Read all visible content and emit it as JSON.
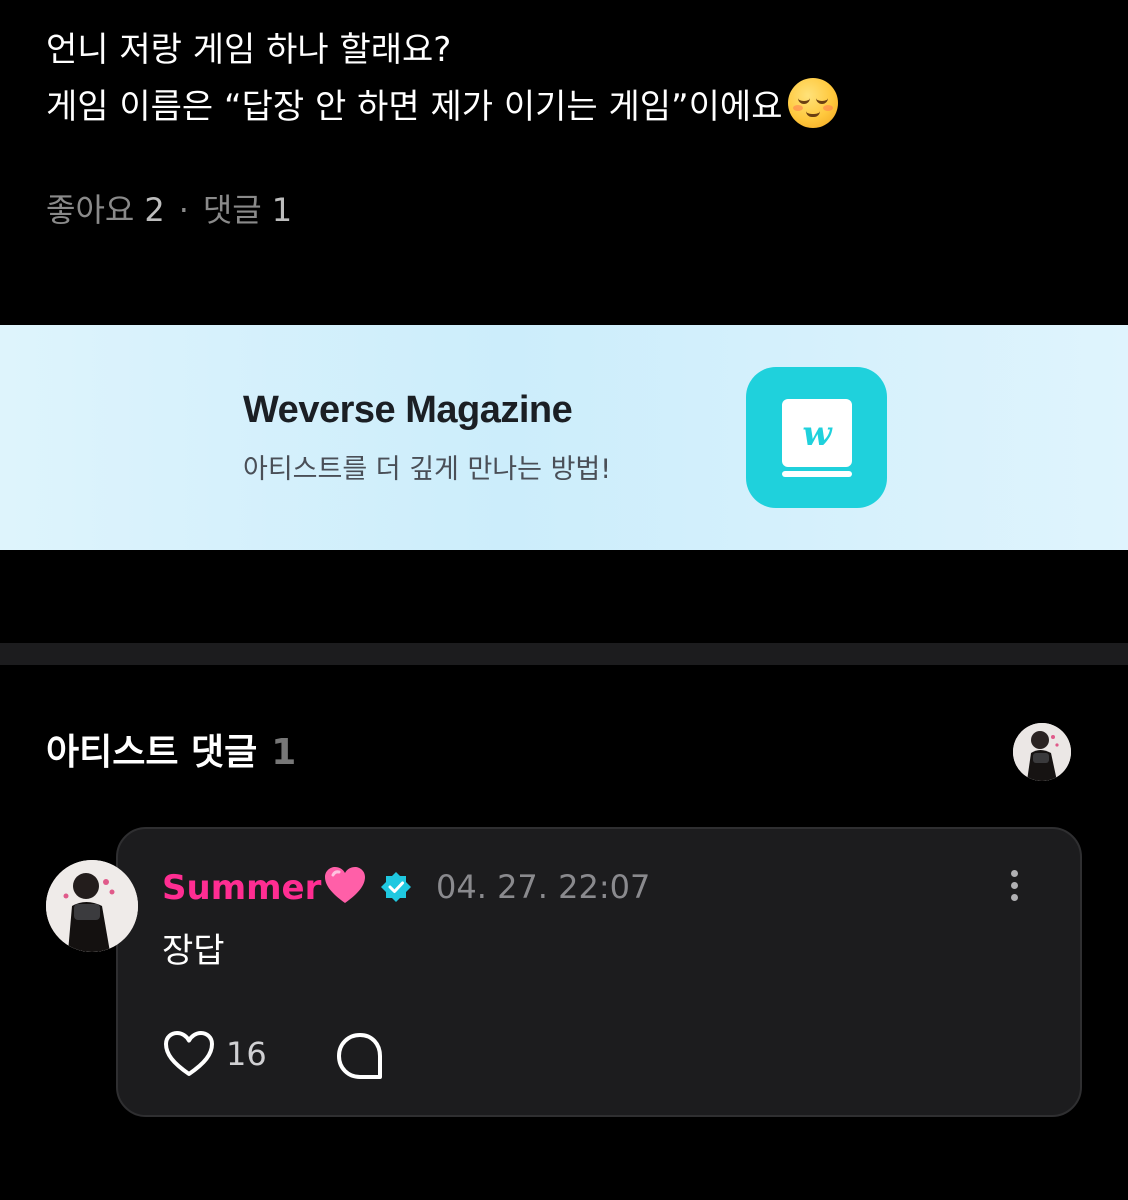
{
  "post": {
    "line1": "언니 저랑 게임 하나 할래요?",
    "line2": "게임 이름은 “답장 안 하면 제가 이기는 게임”이에요",
    "emoji": "relieved-face-emoji"
  },
  "stats": {
    "likes_label": "좋아요",
    "likes_count": "2",
    "separator": "·",
    "comments_label": "댓글",
    "comments_count": "1"
  },
  "banner": {
    "title": "Weverse Magazine",
    "subtitle": "아티스트를 더 깊게 만나는 방법!",
    "icon": "weverse-magazine-book-icon",
    "icon_color": "#1fd1dc"
  },
  "artist_comments": {
    "title": "아티스트 댓글",
    "count": "1"
  },
  "comment": {
    "author": "Summer",
    "author_color": "#ff2d92",
    "author_emoji": "pink-heart-emoji",
    "verified_icon": "verified-badge-icon",
    "verified_color": "#1fc8e0",
    "timestamp": "04. 27. 22:07",
    "text": "장답",
    "like_count": "16",
    "like_icon": "heart-outline-icon",
    "reply_icon": "speech-bubble-icon",
    "menu_icon": "vertical-ellipsis-icon"
  }
}
